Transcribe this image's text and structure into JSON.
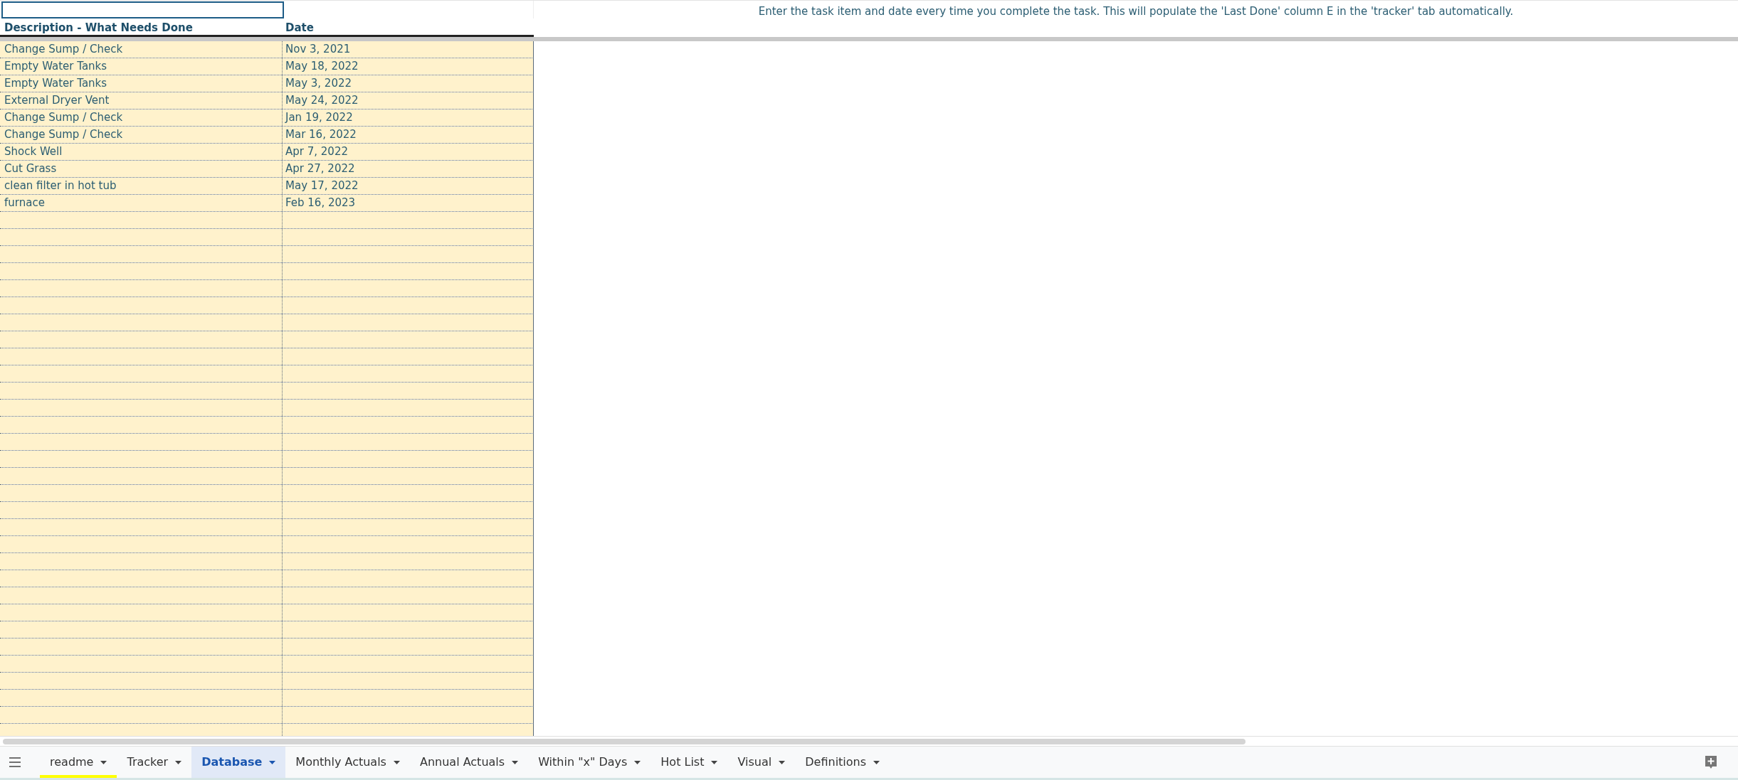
{
  "note": "Enter the task item and date every time you complete the task. This will populate the 'Last Done' column E in the 'tracker' tab automatically.",
  "table": {
    "columns": [
      "Description - What Needs Done",
      "Date"
    ],
    "rows": [
      {
        "description": "Change Sump / Check",
        "date": "Nov 3, 2021"
      },
      {
        "description": "Empty Water Tanks",
        "date": "May 18, 2022"
      },
      {
        "description": "Empty Water Tanks",
        "date": "May 3, 2022"
      },
      {
        "description": "External Dryer Vent",
        "date": "May 24, 2022"
      },
      {
        "description": "Change Sump / Check",
        "date": "Jan 19, 2022"
      },
      {
        "description": "Change Sump / Check",
        "date": "Mar 16, 2022"
      },
      {
        "description": "Shock Well",
        "date": "Apr 7, 2022"
      },
      {
        "description": "Cut Grass",
        "date": "Apr 27, 2022"
      },
      {
        "description": "clean filter in hot tub",
        "date": "May 17, 2022"
      },
      {
        "description": "furnace",
        "date": "Feb 16, 2023"
      }
    ]
  },
  "sheet_tabs": [
    {
      "label": "readme",
      "selected": false,
      "color": "#ffff00"
    },
    {
      "label": "Tracker",
      "selected": false
    },
    {
      "label": "Database",
      "selected": true
    },
    {
      "label": "Monthly Actuals",
      "selected": false
    },
    {
      "label": "Annual Actuals",
      "selected": false
    },
    {
      "label": "Within \"x\" Days",
      "selected": false
    },
    {
      "label": "Hot List",
      "selected": false
    },
    {
      "label": "Visual",
      "selected": false
    },
    {
      "label": "Definitions",
      "selected": false
    }
  ]
}
